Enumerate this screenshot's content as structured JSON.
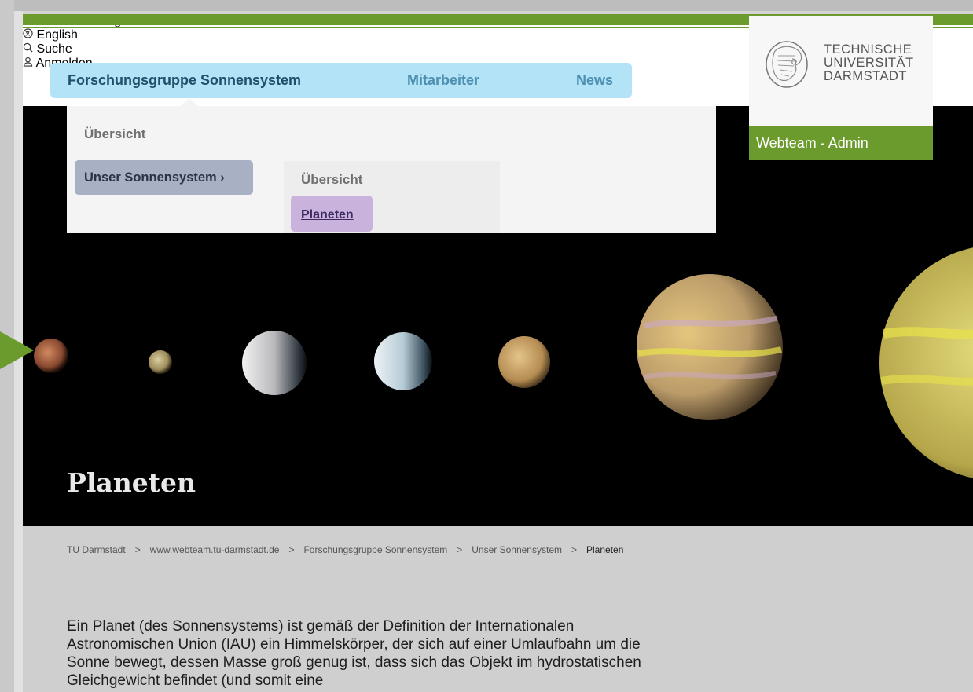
{
  "service_nav": [
    {
      "label": "Schnelleinstieg",
      "icon": "external-link-icon"
    },
    {
      "label": "English",
      "icon": "language-icon"
    },
    {
      "label": "Suche",
      "icon": "search-icon"
    },
    {
      "label": "Anmelden",
      "icon": "user-icon"
    }
  ],
  "main_nav": {
    "items": [
      {
        "label": "Forschungsgruppe Sonnensystem",
        "state": "active"
      },
      {
        "label": "Mitarbeiter",
        "state": "inactive"
      },
      {
        "label": "News",
        "state": "inactive"
      }
    ]
  },
  "flyout": {
    "overview": "Übersicht",
    "section_button": "Unser Sonnensystem ›",
    "submenu": {
      "overview": "Übersicht",
      "active_item": "Planeten"
    }
  },
  "logo": {
    "lines": [
      "TECHNISCHE",
      "UNIVERSITÄT",
      "DARMSTADT"
    ]
  },
  "admin_label": "Webteam - Admin",
  "hero": {
    "title": "Planeten"
  },
  "breadcrumb": {
    "items": [
      "TU Darmstadt",
      "www.webteam.tu-darmstadt.de",
      "Forschungsgruppe Sonnensystem",
      "Unser Sonnensystem",
      "Planeten"
    ],
    "separator": ">"
  },
  "intro_text": "Ein Planet (des Sonnensystems) ist gemäß der Definition der Internationalen Astronomischen Union (IAU) ein Himmelskörper, der sich auf einer Umlaufbahn um die Sonne bewegt, dessen Masse groß genug ist, dass sich das Objekt im hydrostatischen Gleichgewicht befindet (und somit eine",
  "colors": {
    "brand_green": "#6b9a2d",
    "nav_bg": "#b3e3f7",
    "section_button": "#a8b0c4",
    "active_submenu": "#c9b3dd"
  }
}
